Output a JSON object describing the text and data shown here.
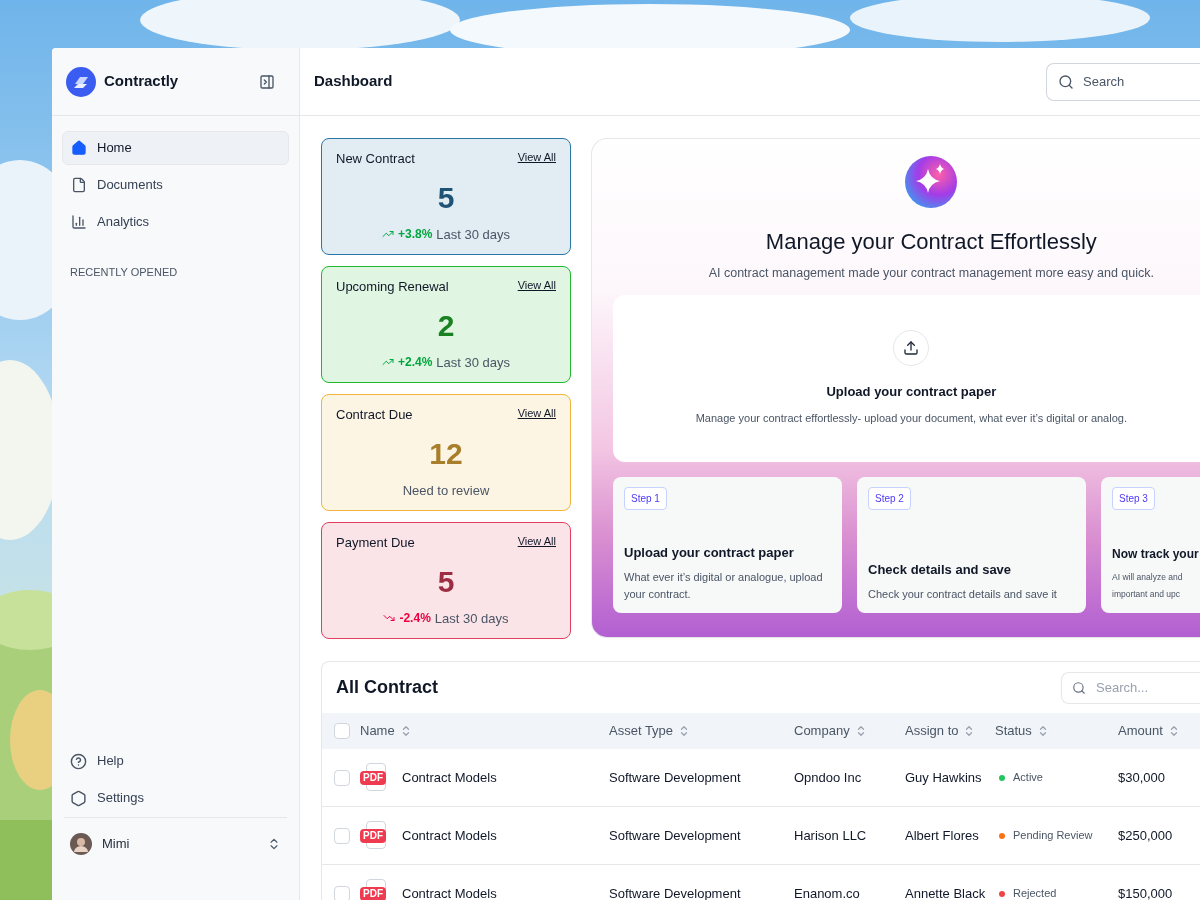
{
  "brand": {
    "name": "Contractly"
  },
  "sidebar": {
    "items": [
      {
        "label": "Home",
        "selected": true
      },
      {
        "label": "Documents",
        "selected": false
      },
      {
        "label": "Analytics",
        "selected": false
      }
    ],
    "section_title": "RECENTLY OPENED",
    "footer_items": [
      {
        "label": "Help"
      },
      {
        "label": "Settings"
      }
    ],
    "user": {
      "name": "Mimi"
    }
  },
  "header": {
    "title": "Dashboard",
    "search": {
      "placeholder": "Search"
    }
  },
  "stats": [
    {
      "title": "New Contract",
      "link": "View All",
      "value": "5",
      "color": "#2b76a8",
      "kind": "rise",
      "trend": {
        "change": "+3.8%",
        "period": "Last 30 days"
      }
    },
    {
      "title": "Upcoming Renewal",
      "link": "View All",
      "value": "2",
      "color": "#22b82e",
      "kind": "rise",
      "trend": {
        "change": "+2.4%",
        "period": "Last 30 days"
      }
    },
    {
      "title": "Contract Due",
      "link": "View All",
      "value": "12",
      "color": "#f0b43c",
      "kind": "note",
      "note": "Need to review"
    },
    {
      "title": "Payment Due",
      "link": "View All",
      "value": "5",
      "color": "#e0405e",
      "kind": "fall",
      "trend": {
        "change": "-2.4%",
        "period": "Last 30 days"
      }
    }
  ],
  "hero": {
    "title": "Manage your Contract Effortlessly",
    "subtitle": "AI contract management made your contract management more easy and quick.",
    "upload": {
      "title": "Upload your contract paper",
      "description": "Manage your contract effortlessly- upload your document, what ever it’s digital or analog."
    },
    "steps": [
      {
        "badge": "Step 1",
        "title": "Upload your contract paper",
        "description": "What ever it’s digital or analogue, upload your contract."
      },
      {
        "badge": "Step 2",
        "title": "Check details and save",
        "description": "Check your contract details and save it"
      },
      {
        "badge": "Step 3",
        "title": "Now track your",
        "description": "AI will analyze and important and upc"
      }
    ]
  },
  "table": {
    "title": "All Contract",
    "search": {
      "placeholder": "Search..."
    },
    "columns": [
      "Name",
      "Asset Type",
      "Company",
      "Assign to",
      "Status",
      "Amount"
    ],
    "select_all": {
      "checked": false
    },
    "rows": [
      {
        "checked": false,
        "file_type": "PDF",
        "name": "Contract Models",
        "asset_type": "Software Development",
        "company": "Opndoo Inc",
        "assignee": "Guy Hawkins",
        "status": "Active",
        "color": "#22c55e",
        "amount": "$30,000"
      },
      {
        "checked": false,
        "file_type": "PDF",
        "name": "Contract Models",
        "asset_type": "Software Development",
        "company": "Harison LLC",
        "assignee": "Albert Flores",
        "status": "Pending Review",
        "color": "#f97316",
        "amount": "$250,000"
      },
      {
        "checked": false,
        "file_type": "PDF",
        "name": "Contract Models",
        "asset_type": "Software Development",
        "company": "Enanom.co",
        "assignee": "Annette Black",
        "status": "Rejected",
        "color": "#ef4444",
        "amount": "$150,000"
      }
    ]
  }
}
